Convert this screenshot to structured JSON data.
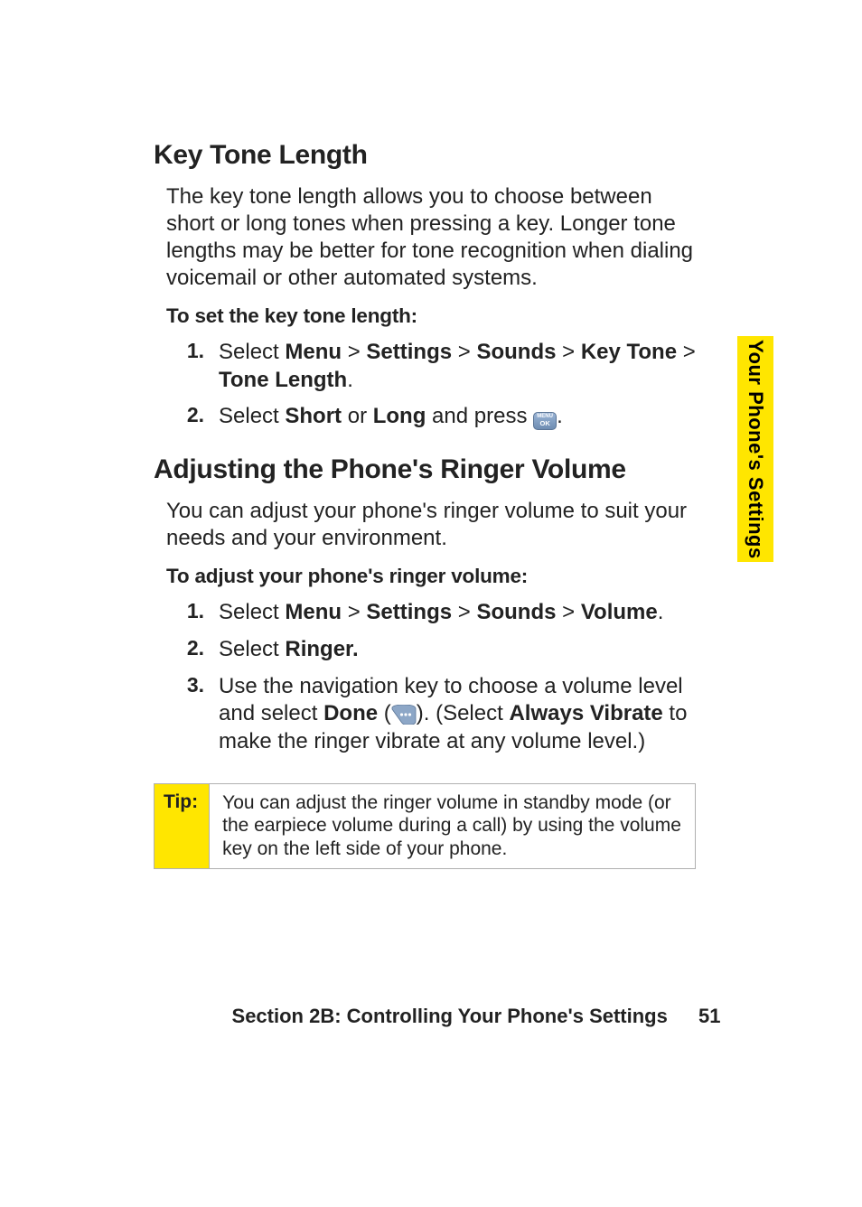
{
  "sideTab": {
    "label": "Your Phone's Settings"
  },
  "section1": {
    "heading": "Key Tone Length",
    "intro": "The key tone length allows you to choose between short or long tones when pressing a key. Longer tone lengths may be better for tone recognition when dialing voicemail or other automated systems.",
    "procLead": "To set the key tone length:",
    "steps": {
      "s1": {
        "num": "1.",
        "pre": "Select ",
        "menu": "Menu",
        "gt1": " > ",
        "settings": "Settings",
        "gt2": " > ",
        "sounds": "Sounds",
        "gt3": " > ",
        "keytone": "Key Tone",
        "gt4": " > ",
        "tonelength": "Tone Length",
        "post": "."
      },
      "s2": {
        "num": "2.",
        "pre": "Select ",
        "short": "Short",
        "or": " or ",
        "long": "Long",
        "andpress": " and press ",
        "post": "."
      }
    }
  },
  "section2": {
    "heading": "Adjusting the Phone's Ringer Volume",
    "intro": "You can adjust your phone's ringer volume to suit your needs and your environment.",
    "procLead": "To adjust your phone's ringer volume:",
    "steps": {
      "s1": {
        "num": "1.",
        "pre": "Select ",
        "menu": "Menu",
        "gt1": " > ",
        "settings": "Settings",
        "gt2": " > ",
        "sounds": "Sounds",
        "gt3": " > ",
        "volume": "Volume",
        "post": "."
      },
      "s2": {
        "num": "2.",
        "pre": "Select ",
        "ringer": "Ringer.",
        "post": ""
      },
      "s3": {
        "num": "3.",
        "pre": "Use the navigation key to choose a volume level and select ",
        "done": "Done",
        "open": " (",
        "close": "). (Select ",
        "always": "Always Vibrate",
        "tail": " to make the ringer vibrate at any volume level.)"
      }
    }
  },
  "tip": {
    "label": "Tip:",
    "text": "You can adjust the ringer volume in standby mode (or the earpiece volume during a call) by using the volume key on the left side of your phone."
  },
  "footer": {
    "section": "Section 2B: Controlling Your Phone's Settings",
    "page": "51"
  }
}
